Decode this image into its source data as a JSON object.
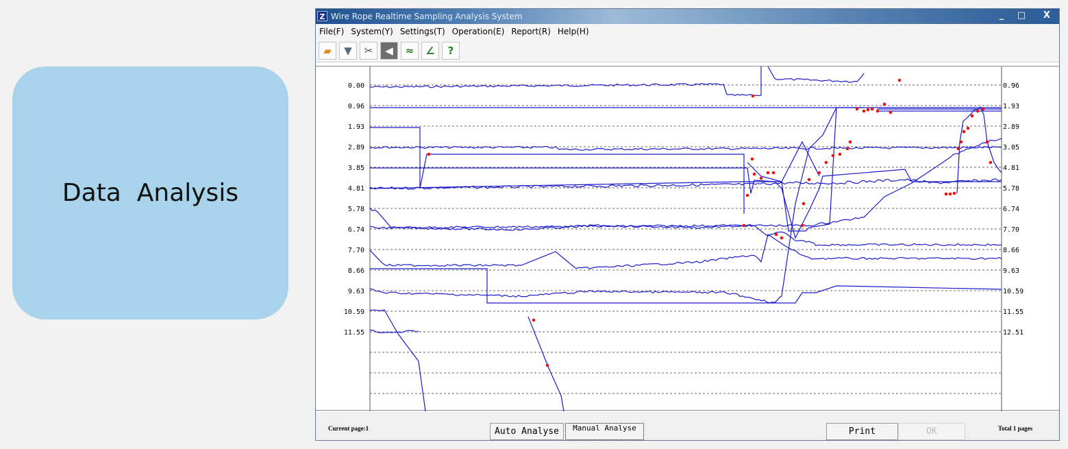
{
  "slide": {
    "label": "Data  Analysis"
  },
  "window": {
    "title": "Wire Rope Realtime Sampling Analysis System",
    "app_icon": "Z",
    "controls": {
      "minimize": "_",
      "maximize": "□",
      "close": "X"
    }
  },
  "menu": [
    "File(F)",
    "System(Y)",
    "Settings(T)",
    "Operation(E)",
    "Report(R)",
    "Help(H)"
  ],
  "toolbar": [
    {
      "icon": "folder-icon",
      "glyph": "▰",
      "color": "#e08a1e"
    },
    {
      "icon": "filter-icon",
      "glyph": "▼",
      "color": "#5a6a7a"
    },
    {
      "icon": "tools-icon",
      "glyph": "✂",
      "color": "#4a4a4a"
    },
    {
      "icon": "sensor-icon",
      "glyph": "◀",
      "color": "#ffffff",
      "pressed": true
    },
    {
      "icon": "waveform-icon",
      "glyph": "≈",
      "color": "#2d7a2d"
    },
    {
      "icon": "chart-line-icon",
      "glyph": "∠",
      "color": "#2d7a2d"
    },
    {
      "icon": "help-icon",
      "glyph": "?",
      "color": "#1f8a1f"
    }
  ],
  "chart": {
    "left_ticks": [
      "0.00",
      "0.96",
      "1.93",
      "2.89",
      "3.85",
      "4.81",
      "5.78",
      "6.74",
      "7.70",
      "8.66",
      "9.63",
      "10.59",
      "11.55"
    ],
    "right_ticks": [
      "0.96",
      "1.93",
      "2.89",
      "3.05",
      "4.81",
      "5.78",
      "6.74",
      "7.70",
      "8.66",
      "9.63",
      "10.59",
      "11.55",
      "12.51"
    ],
    "line_color": "#1a1acc",
    "marker_color": "#ee1111"
  },
  "status": {
    "current_page": "Current page:1",
    "auto_analyse": "Auto Analyse",
    "manual_analyse": "Manual Analyse",
    "print": "Print",
    "ok": "OK",
    "total_pages": "Total 1 pages"
  }
}
